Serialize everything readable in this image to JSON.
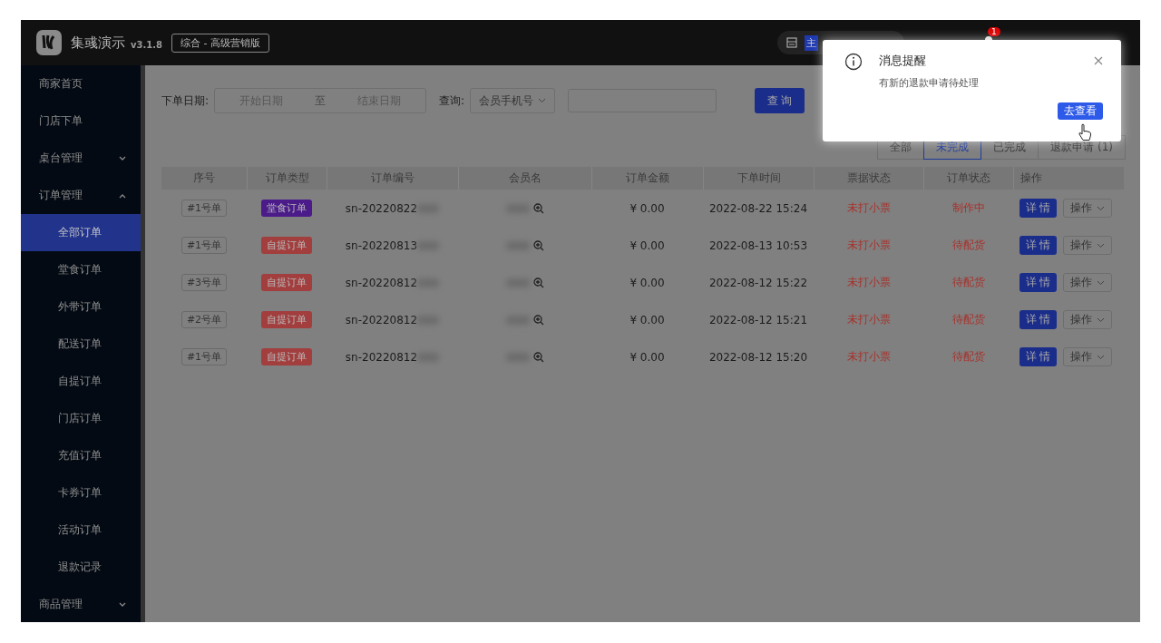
{
  "app": {
    "name": "集彧演示",
    "version": "v3.1.8",
    "edition": "综合 - 高级营销版"
  },
  "header": {
    "store_badge": "主",
    "notification_count": "1"
  },
  "sidebar": {
    "items": [
      {
        "label": "商家首页",
        "selected": false
      },
      {
        "label": "门店下单",
        "selected": false
      },
      {
        "label": "桌台管理",
        "selected": false,
        "expanded": false
      },
      {
        "label": "订单管理",
        "selected": false,
        "expanded": true,
        "children": [
          {
            "label": "全部订单",
            "selected": true
          },
          {
            "label": "堂食订单",
            "selected": false
          },
          {
            "label": "外带订单",
            "selected": false
          },
          {
            "label": "配送订单",
            "selected": false
          },
          {
            "label": "自提订单",
            "selected": false
          },
          {
            "label": "门店订单",
            "selected": false
          },
          {
            "label": "充值订单",
            "selected": false
          },
          {
            "label": "卡券订单",
            "selected": false
          },
          {
            "label": "活动订单",
            "selected": false
          },
          {
            "label": "退款记录",
            "selected": false
          }
        ]
      },
      {
        "label": "商品管理",
        "selected": false,
        "expanded": false
      }
    ]
  },
  "filters": {
    "date_label": "下单日期:",
    "start_placeholder": "开始日期",
    "separator": "至",
    "end_placeholder": "结束日期",
    "query_label": "查询:",
    "query_type": "会员手机号",
    "query_button": "查 询"
  },
  "tabs": [
    {
      "label": "全部",
      "selected": false
    },
    {
      "label": "未完成",
      "selected": true
    },
    {
      "label": "已完成",
      "selected": false
    },
    {
      "label": "退款申请 (1)",
      "selected": false
    }
  ],
  "table": {
    "columns": [
      "序号",
      "订单类型",
      "订单编号",
      "会员名",
      "订单金额",
      "下单时间",
      "票据状态",
      "订单状态",
      "操作"
    ],
    "rows": [
      {
        "seq": "#1号单",
        "type": "堂食订单",
        "color": "#4b1b8a",
        "order_no": "sn-20220822",
        "amount": "¥ 0.00",
        "time": "2022-08-22 15:24",
        "ticket_status": "未打小票",
        "order_status": "制作中",
        "detail_button": "详 情",
        "action_button": "操作"
      },
      {
        "seq": "#1号单",
        "type": "自提订单",
        "color": "#a23e3e",
        "order_no": "sn-20220813",
        "amount": "¥ 0.00",
        "time": "2022-08-13 10:53",
        "ticket_status": "未打小票",
        "order_status": "待配货",
        "detail_button": "详 情",
        "action_button": "操作"
      },
      {
        "seq": "#3号单",
        "type": "自提订单",
        "color": "#a23e3e",
        "order_no": "sn-20220812",
        "amount": "¥ 0.00",
        "time": "2022-08-12 15:22",
        "ticket_status": "未打小票",
        "order_status": "待配货",
        "detail_button": "详 情",
        "action_button": "操作"
      },
      {
        "seq": "#2号单",
        "type": "自提订单",
        "color": "#a23e3e",
        "order_no": "sn-20220812",
        "amount": "¥ 0.00",
        "time": "2022-08-12 15:21",
        "ticket_status": "未打小票",
        "order_status": "待配货",
        "detail_button": "详 情",
        "action_button": "操作"
      },
      {
        "seq": "#1号单",
        "type": "自提订单",
        "color": "#a23e3e",
        "order_no": "sn-20220812",
        "amount": "¥ 0.00",
        "time": "2022-08-12 15:20",
        "ticket_status": "未打小票",
        "order_status": "待配货",
        "detail_button": "详 情",
        "action_button": "操作"
      }
    ]
  },
  "notification": {
    "title": "消息提醒",
    "message": "有新的退款申请待处理",
    "button": "去查看"
  }
}
